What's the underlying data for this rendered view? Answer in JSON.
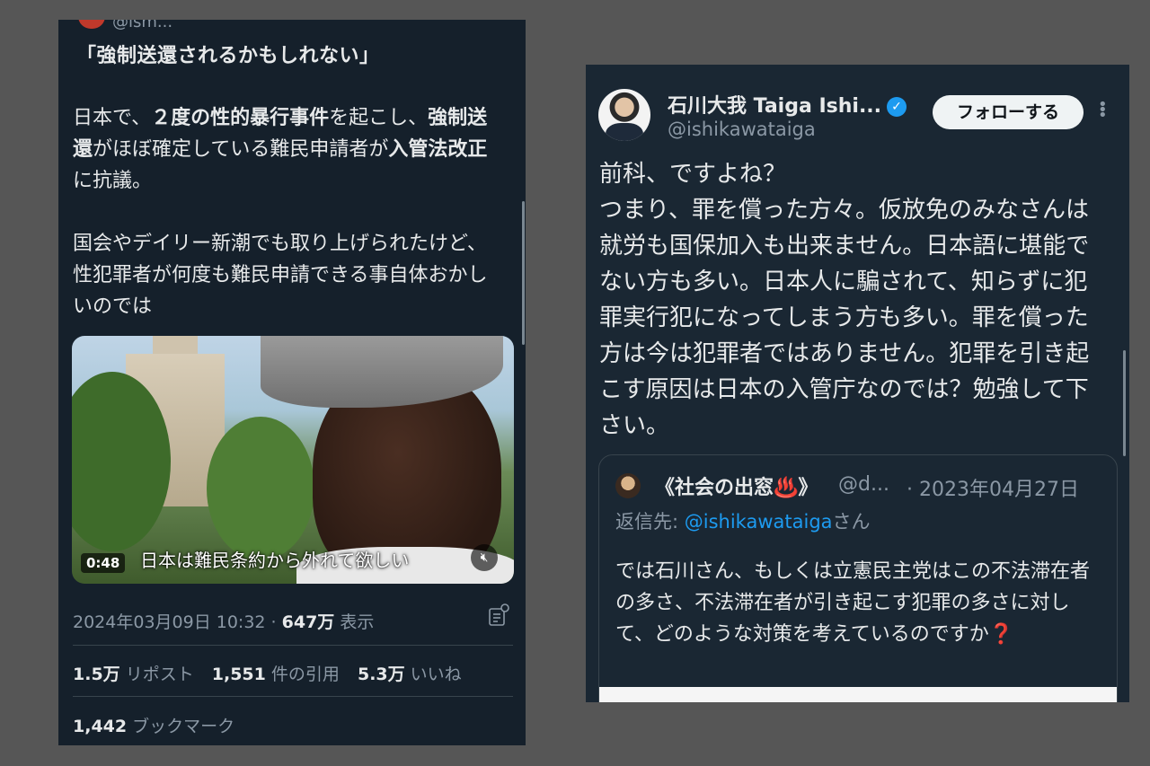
{
  "left_tweet": {
    "handle_partial": "@ism...",
    "headline": "「強制送還されるかもしれない」",
    "body_line1_a": "日本で、",
    "body_line1_bold": "２度の性的暴行事件",
    "body_line1_b": "を起こし、",
    "body_line1_bold2": "強",
    "body_line2_bold": "制送還",
    "body_line2_a": "がほぼ確定している難民申請者が",
    "body_line2_bold2": "入",
    "body_line3_bold": "管法改正",
    "body_line3_a": "に抗議。",
    "body_para2": "国会やデイリー新潮でも取り上げられたけど、性犯罪者が何度も難民申請できる事自体おかしいのでは",
    "video": {
      "duration": "0:48",
      "caption": "日本は難民条約から外れて欲しい",
      "mute_icon": "mute-icon"
    },
    "timestamp": "2024年03月09日 10:32",
    "separator": " · ",
    "views_count": "647万",
    "views_label": " 表示",
    "reposts_count": "1.5万",
    "reposts_label": " リポスト",
    "quotes_count": "1,551",
    "quotes_label": " 件の引用",
    "likes_count": "5.3万",
    "likes_label": " いいね",
    "bookmarks_count": "1,442",
    "bookmarks_label": " ブックマーク"
  },
  "right_tweet": {
    "name": "石川大我 Taiga Ishi...",
    "handle": "@ishikawataiga",
    "follow_label": "フォローする",
    "more_icon": "⋮",
    "body": "前科、ですよね？\nつまり、罪を償った方々。仮放免のみなさんは就労も国保加入も出来ません。日本語に堪能でない方も多い。日本人に騙されて、知らずに犯罪実行犯になってしまう方も多い。罪を償った方は今は犯罪者ではありません。犯罪を引き起こす原因は日本の入管庁なのでは？勉強して下さい。",
    "quoted": {
      "name": "《社会の出窓♨️》",
      "handle": "@d...",
      "date": "· 2023年04月27日",
      "reply_prefix": "返信先: ",
      "reply_mention": "@ishikawataiga",
      "reply_suffix": "さん",
      "body": "では石川さん、もしくは立憲民主党はこの不法滞在者の多さ、不法滞在者が引き起こす犯罪の多さに対して、どのような対策を考えているのですか❓"
    }
  },
  "colors": {
    "background": "#565656",
    "panel": "#15202b",
    "text": "#e7e9ea",
    "muted": "#8b98a5",
    "accent": "#1d9bf0"
  }
}
